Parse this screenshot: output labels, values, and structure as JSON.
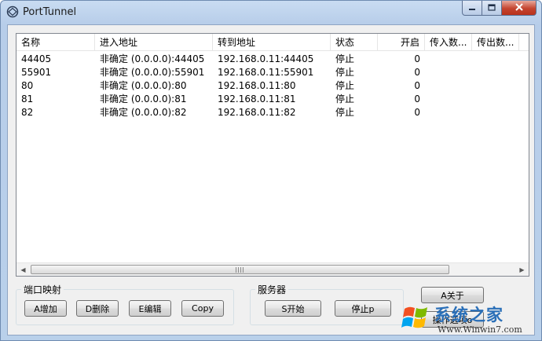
{
  "window": {
    "title": "PortTunnel"
  },
  "table": {
    "columns": [
      {
        "label": "名称"
      },
      {
        "label": "进入地址"
      },
      {
        "label": "转到地址"
      },
      {
        "label": "状态"
      },
      {
        "label": "开启"
      },
      {
        "label": "传入数..."
      },
      {
        "label": "传出数..."
      }
    ],
    "rows": [
      {
        "name": "44405",
        "in_addr": "非确定 (0.0.0.0):44405",
        "out_addr": "192.168.0.11:44405",
        "status": "停止",
        "on": "0"
      },
      {
        "name": "55901",
        "in_addr": "非确定 (0.0.0.0):55901",
        "out_addr": "192.168.0.11:55901",
        "status": "停止",
        "on": "0"
      },
      {
        "name": "80",
        "in_addr": "非确定 (0.0.0.0):80",
        "out_addr": "192.168.0.11:80",
        "status": "停止",
        "on": "0"
      },
      {
        "name": "81",
        "in_addr": "非确定 (0.0.0.0):81",
        "out_addr": "192.168.0.11:81",
        "status": "停止",
        "on": "0"
      },
      {
        "name": "82",
        "in_addr": "非确定 (0.0.0.0):82",
        "out_addr": "192.168.0.11:82",
        "status": "停止",
        "on": "0"
      }
    ]
  },
  "port_group": {
    "label": "端口映射",
    "add": "A增加",
    "delete": "D删除",
    "edit": "E编辑",
    "copy": "Copy"
  },
  "server_group": {
    "label": "服务器",
    "start": "S开始",
    "stop": "停止p"
  },
  "about_button": "A关于",
  "options_button": "操作选项o",
  "watermark": {
    "text": "系统之家",
    "url": "Www.Winwin7.com"
  },
  "colors": {
    "close_button": "#c4442f",
    "titlebar": "#c9dcf2",
    "watermark": "#2a6fb8"
  }
}
